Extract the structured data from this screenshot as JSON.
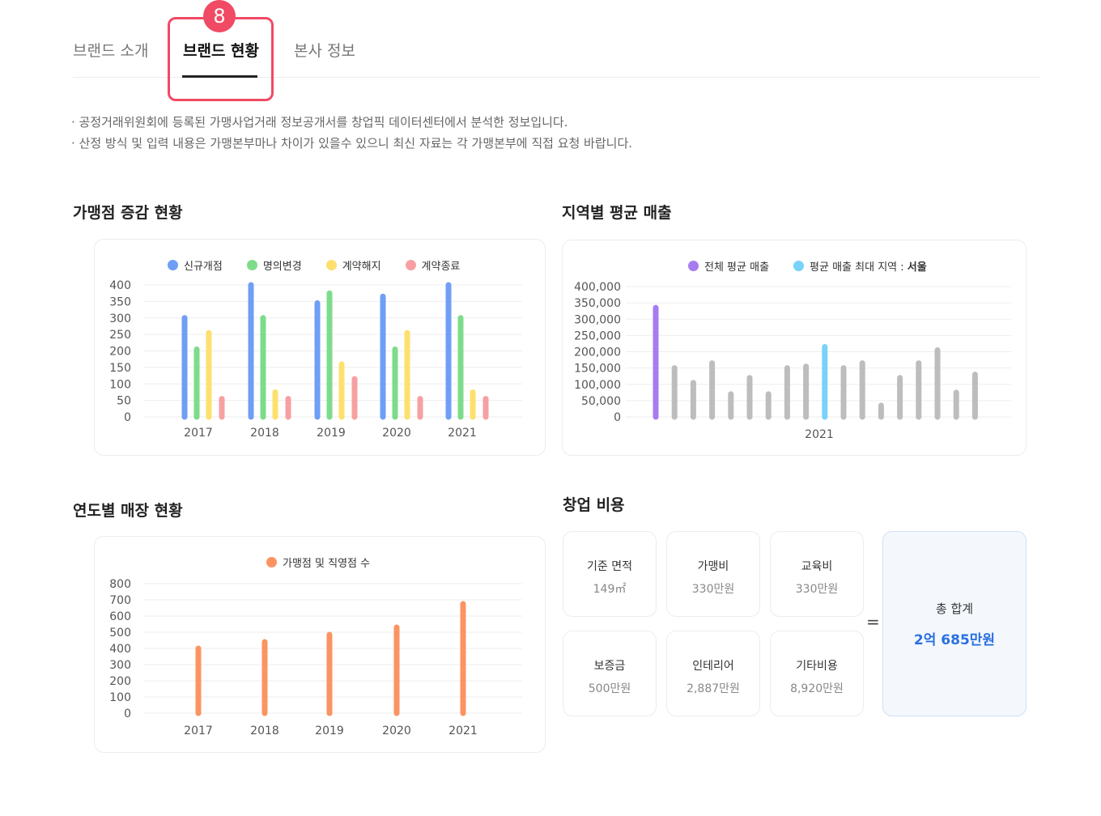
{
  "tabs": [
    {
      "label": "브랜드 소개"
    },
    {
      "label": "브랜드 현황"
    },
    {
      "label": "본사 정보"
    }
  ],
  "step_badge": "8",
  "notices": [
    "· 공정거래위원회에 등록된 가맹사업거래 정보공개서를 창업픽 데이터센터에서 분석한 정보입니다.",
    "· 산정 방식 및 입력 내용은 가맹본부마나 차이가 있을수 있으니 최신 자료는 각 가맹본부에 직접 요청 바랍니다."
  ],
  "sections": {
    "growth": "가맹점 증감 현황",
    "regional": "지역별 평균 매출",
    "stores": "연도별 매장 현황",
    "costs": "창업 비용"
  },
  "colors": {
    "blue": "#6f9ef5",
    "green": "#7ddc8a",
    "yellow": "#fde06e",
    "red": "#f7a0a3",
    "purple": "#a77cf0",
    "cyan": "#78d2f9",
    "gray": "#bdbdbd",
    "orange": "#fb9461",
    "accent_red": "#f04a64",
    "total_blue": "#2a70e0"
  },
  "chart_data": [
    {
      "type": "bar",
      "categories": [
        "2017",
        "2018",
        "2019",
        "2020",
        "2021"
      ],
      "yticks": [
        "0",
        "50",
        "100",
        "150",
        "200",
        "250",
        "300",
        "350",
        "400"
      ],
      "ylim": [
        0,
        400
      ],
      "legend_position": "top-center",
      "grid": true,
      "series": [
        {
          "name": "신규개점",
          "color": "#6f9ef5",
          "values": [
            300,
            400,
            345,
            365,
            400
          ]
        },
        {
          "name": "명의변경",
          "color": "#7ddc8a",
          "values": [
            205,
            300,
            375,
            205,
            300
          ]
        },
        {
          "name": "계약해지",
          "color": "#fde06e",
          "values": [
            255,
            75,
            160,
            255,
            75
          ]
        },
        {
          "name": "계약종료",
          "color": "#f7a0a3",
          "values": [
            55,
            55,
            115,
            55,
            55
          ]
        }
      ]
    },
    {
      "type": "bar",
      "categories": [
        "2021"
      ],
      "yticks": [
        "0",
        "50,000",
        "100,000",
        "150,000",
        "200,000",
        "250,000",
        "300,000",
        "350,000",
        "400,000"
      ],
      "ylim": [
        0,
        400000
      ],
      "legend_position": "top-center",
      "grid": true,
      "legend": [
        {
          "name": "전체 평균 매출",
          "color": "#a77cf0"
        },
        {
          "name": "평균 매출 최대 지역 : ",
          "highlight": "서울",
          "color": "#78d2f9"
        }
      ],
      "values": [
        335000,
        150000,
        105000,
        165000,
        70000,
        120000,
        70000,
        150000,
        155000,
        215000,
        150000,
        165000,
        35000,
        120000,
        165000,
        205000,
        75000,
        130000
      ],
      "value_colors": [
        "#a77cf0",
        "#bdbdbd",
        "#bdbdbd",
        "#bdbdbd",
        "#bdbdbd",
        "#bdbdbd",
        "#bdbdbd",
        "#bdbdbd",
        "#bdbdbd",
        "#78d2f9",
        "#bdbdbd",
        "#bdbdbd",
        "#bdbdbd",
        "#bdbdbd",
        "#bdbdbd",
        "#bdbdbd",
        "#bdbdbd",
        "#bdbdbd"
      ]
    },
    {
      "type": "bar",
      "categories": [
        "2017",
        "2018",
        "2019",
        "2020",
        "2021"
      ],
      "yticks": [
        "0",
        "100",
        "200",
        "300",
        "400",
        "500",
        "600",
        "700",
        "800"
      ],
      "ylim": [
        0,
        800
      ],
      "legend_position": "top-center",
      "grid": true,
      "series": [
        {
          "name": "가맹점 및 직영점 수",
          "color": "#fb9461",
          "values": [
            400,
            440,
            485,
            530,
            675
          ]
        }
      ]
    }
  ],
  "costs": {
    "items": [
      {
        "label": "기준 면적",
        "value": "149㎡"
      },
      {
        "label": "가맹비",
        "value": "330만원"
      },
      {
        "label": "교육비",
        "value": "330만원"
      },
      {
        "label": "보증금",
        "value": "500만원"
      },
      {
        "label": "인테리어",
        "value": "2,887만원"
      },
      {
        "label": "기타비용",
        "value": "8,920만원"
      }
    ],
    "equals": "=",
    "total_label": "총 합계",
    "total_value": "2억 685만원"
  }
}
